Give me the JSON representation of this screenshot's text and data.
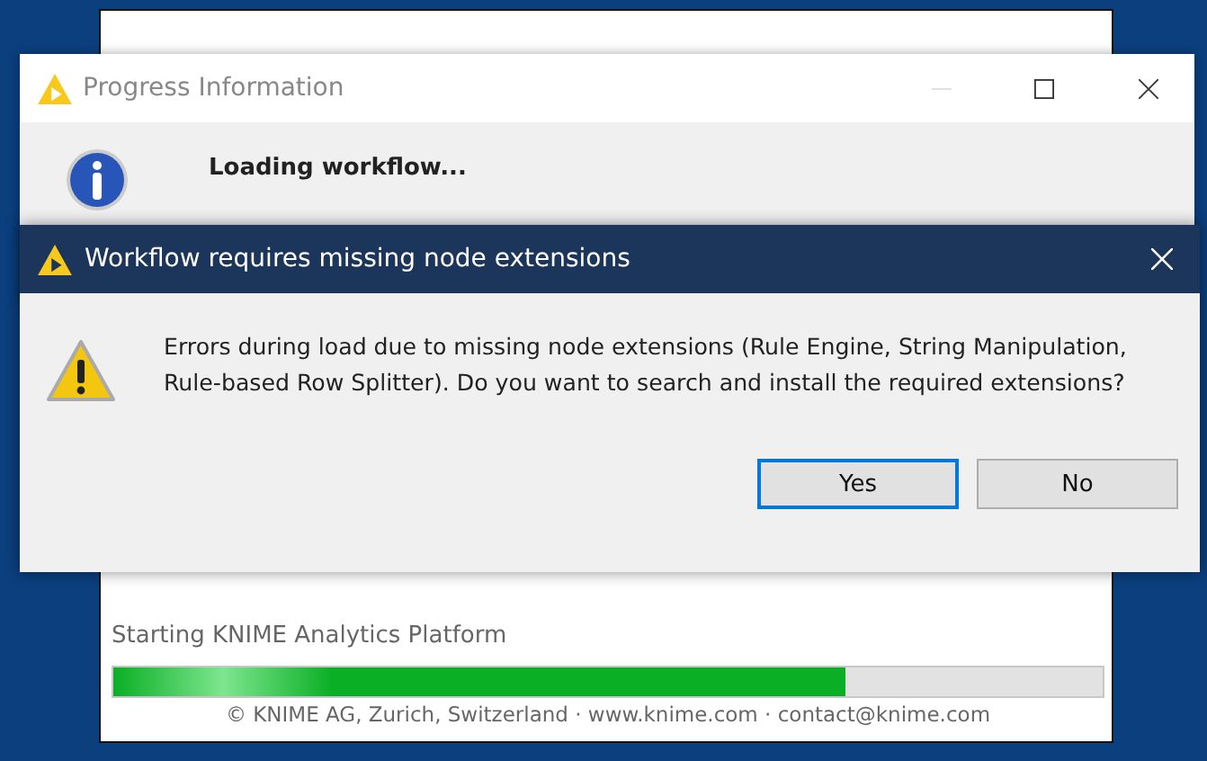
{
  "splash": {
    "status": "Starting KNIME Analytics Platform",
    "level": 0.74,
    "footer": "© KNIME AG, Zurich, Switzerland · www.knime.com · contact@knime.com"
  },
  "progress_window": {
    "title": "Progress Information",
    "message": "Loading workflow..."
  },
  "dialog": {
    "title": "Workflow requires missing node extensions",
    "message": "Errors during load due to missing node extensions (Rule Engine, String Manipulation, Rule-based Row Splitter). Do you want to search and install the required extensions?",
    "buttons": [
      {
        "label": "Yes",
        "selected": true
      },
      {
        "label": "No",
        "selected": false
      }
    ]
  }
}
